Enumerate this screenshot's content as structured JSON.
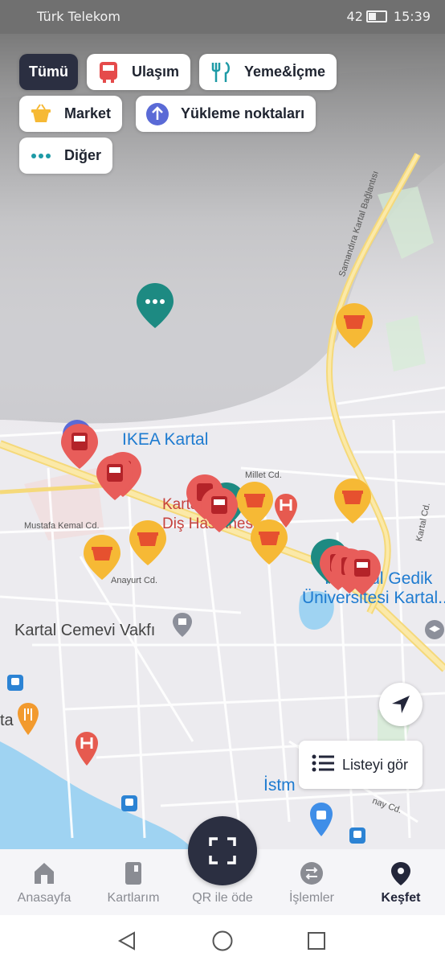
{
  "status_bar": {
    "carrier": "Türk Telekom",
    "battery": "42",
    "time": "15:39"
  },
  "filters": {
    "all": "Tümü",
    "transport": "Ulaşım",
    "food": "Yeme&İçme",
    "market": "Market",
    "topup": "Yükleme noktaları",
    "other": "Diğer"
  },
  "map_labels": {
    "ikea": "IKEA Kartal",
    "kartal": "Kartal",
    "dis": "Diş Hastanesi",
    "cemevi": "Kartal Cemevi Vakfı",
    "univ1": "İstanbul Gedik",
    "univ2": "Üniversitesi Kartal...",
    "istm": "İstm",
    "road_samandira": "Samandıra Kartal Bağlantısı",
    "road_millet": "Millet Cd.",
    "road_mustafa": "Mustafa Kemal Cd.",
    "road_anayurt": "Anayurt Cd.",
    "road_kartal": "Kartal Cd.",
    "road_nay": "nay Cd.",
    "ta": "ta"
  },
  "list_button": "Listeyi gör",
  "tabs": {
    "home": "Anasayfa",
    "cards": "Kartlarım",
    "qr": "QR ile öde",
    "transactions": "İşlemler",
    "explore": "Keşfet"
  },
  "colors": {
    "transport": "#e85d5a",
    "market": "#f6b935",
    "topup": "#5a6ad6",
    "other": "#1d8a82",
    "dark": "#2b2f41"
  }
}
